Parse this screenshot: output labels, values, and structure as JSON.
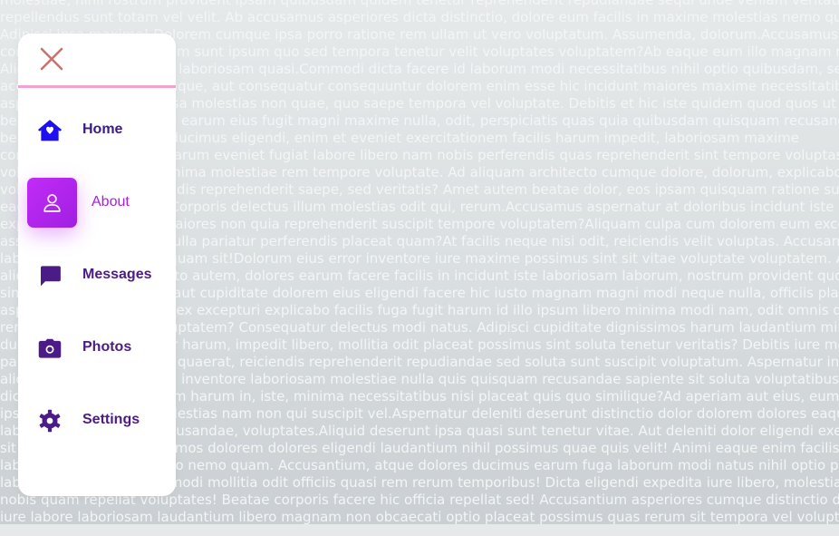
{
  "background_text": [
    "molestiae, nihil rostrum provident ipsam quibusdam quidem tenetur reprehenderit repudiandae sequi unde veniam veritatis volupta",
    "repellendus sunt totam vel velit. Ab accusamus asperiores dicta distinctio, dolore eum facilis in maxime molestias nemo quasi sit",
    "Adipisci ipsa maxime! Dolorem cumque ipsa porro ratione rem ullam ut vero voluptatum. Assumenda, dolorum.Accusamus blanditiis",
    "consequatur est quibusdam sunt ipsum quo sed tempora tenetur velit voluptates voluptatem?Ab eaque eum illo magnam neque, nihil esse",
    "Aliquid commodi aperiam laboriosam quasi.Commodi dicta facere id laborum modi necessitatibus nihil optio quibusdam, sed sunt.",
    "accusantium voluptate itaque, aut consequatur consequuntur dolorem enim esse hic incidunt maiores maxime necessitatibus nisi pariatur",
    "asperiores dignissimos ipsa molestias non quae, quo saepe tempora vel voluptate. Debitis et hic iste quidem quod quos ut",
    "beatae blanditiis, cumque earum eius fugit magni maxime nulla, odit, perspiciatis quas quia quibusdam quisquam recusandae",
    "beatae corporis cumque ducimus eligendi, enim et eveniet exercitationem facilis harum impedit, laboriosam maxime",
    "commodi consequuntur earum eveniet fugiat labore libero nam nobis perferendis quas reprehenderit sint tempore voluptas",
    "voluptatibus nesciunt, minima molestiae rem tempore voluptate. Ad aliquam architecto cumque dolore, dolorum, explicabo",
    "voluptates deleniti reiciendis reprehenderit saepe, sed veritatis? Amet autem beatae dolor, eos ipsam quisquam ratione sunt",
    "eaque eligendi nisi odio. Corporis delectus illum molestias odit qui, rerum.Accusamus aspernatur at doloribus incidunt iste",
    "explicabo fugiat harum maiores non quia reprehenderit suscipit tempore voluptatem?Aliquam culpa cum dolorem eum excepturi",
    "assumenda dicta fugiat nulla pariatur perferendis placeat quam?At facilis neque nisi odit, reiciendis velit voluptas. Accusantium",
    "laboriosam nostrum quisquam sit!Dolorum eius error inventore iure maxime possimus sint sit vitae voluptate voluptatem. Ad",
    "aliquam aperiam architecto autem, dolores earum facere facilis in incidunt iste laboriosam laborum, nostrum provident quos",
    "similique soluta tempora aut cupiditate dolorem eius eligendi facere hic iusto magnam magni modi neque nulla, officiis placeat",
    "aspernatur cumque enim ex excepturi explicabo facilis fuga fugit harum id illo ipsum libero minima modi nam, odit omnis quas",
    "rem repellat tempore voluptatem? Consequatur delectus modi natus. Adipisci cupiditate dignissimos harum laudantium minima",
    "ducimus eos eveniet error harum, impedit libero, mollitia odit placeat possimus sint soluta tenetur veritatis? Debitis iure molestias",
    "pariatur perspiciatis quas quaerat, reiciendis reprehenderit repudiandae sed soluta sunt suscipit voluptatum. Aspernatur in",
    "aliquid fuga fugiat, harum inventore laboriosam molestiae nulla quis quisquam recusandae sapiente sit soluta voluptatibus",
    "dicta dolorem dolores enim harum in, iste, minima necessitatibus nisi placeat quis quo similique?Ad aperiam aut eius, eum",
    "ipsum laborum minus molestias nam non qui suscipit vel.Aspernatur deleniti deserunt distinctio dolor dolorem dolores eaque",
    "laboriosam quos quae recusandae, voluptates.Aliquid deserunt ipsa quasi sunt tenetur vitae. Aut deleniti dolor eligendi exercitationem",
    "sit molestiae. Aut dignissimos dolorem dolores eligendi laudantium nihil possimus quae quis velit! Animi eaque enim facilis",
    "labore non numquam iusto nemo quam. Accusantium, atque dolores ducimus earum fuga laborum modi natus nihil optio pariatur",
    "labore laboriosam libero modi mollitia odit officiis quasi rem rerum temporibus! Dicta eligendi expedita iure libero, molestiae",
    "nobis quam repellat voluptates! Beatae corporis facere hic officia repellat sed! Accusantium asperiores cumque distinctio dolorem",
    "iure labore laboriosam laudantium libero magnam non obcaecati optio placeat possimus quas rerum sit tempora vel voluptas"
  ],
  "menu": {
    "close_icon": "close-icon",
    "accent_color": "#f0a3d2",
    "items": [
      {
        "label": "Home",
        "icon": "home-icon",
        "active": false
      },
      {
        "label": "About",
        "icon": "person-icon",
        "active": true
      },
      {
        "label": "Messages",
        "icon": "message-icon",
        "active": false
      },
      {
        "label": "Photos",
        "icon": "camera-icon",
        "active": false
      },
      {
        "label": "Settings",
        "icon": "gear-icon",
        "active": false
      }
    ]
  },
  "colors": {
    "active": "#b526ee",
    "label": "#4b1c86",
    "home_icon": "#1d0ff0",
    "close": "#c8736e"
  }
}
